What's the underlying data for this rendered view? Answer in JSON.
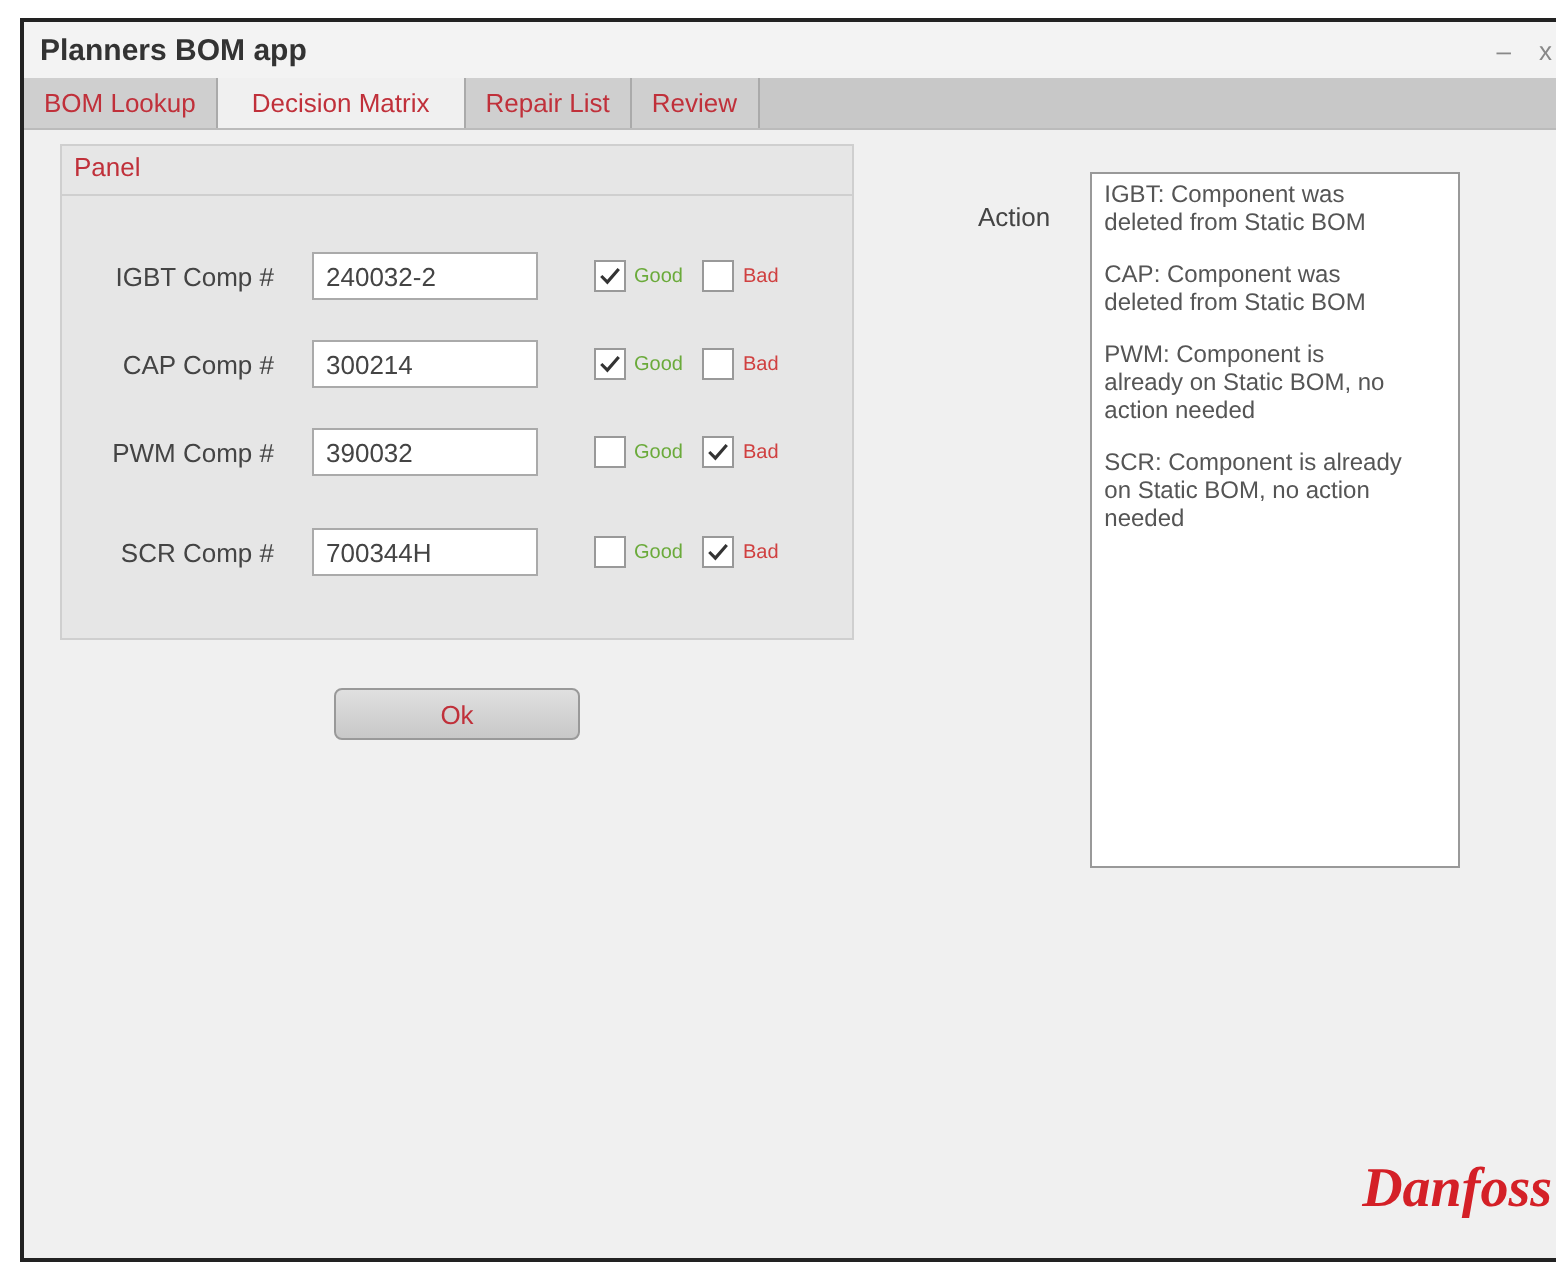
{
  "window": {
    "title": "Planners BOM app",
    "controls": [
      "–",
      "x"
    ]
  },
  "tabs": [
    {
      "label": "BOM Lookup",
      "selected": false
    },
    {
      "label": "Decision Matrix",
      "selected": true
    },
    {
      "label": "Repair List",
      "selected": false
    },
    {
      "label": "Review",
      "selected": false
    }
  ],
  "panel": {
    "title": "Panel",
    "rows": [
      {
        "label": "IGBT Comp #",
        "value": "240032-2",
        "good_label": "Good",
        "good": true,
        "bad_label": "Bad",
        "bad": false
      },
      {
        "label": "CAP Comp #",
        "value": "300214",
        "good_label": "Good",
        "good": true,
        "bad_label": "Bad",
        "bad": false
      },
      {
        "label": "PWM Comp #",
        "value": "390032",
        "good_label": "Good",
        "good": false,
        "bad_label": "Bad",
        "bad": true
      },
      {
        "label": "SCR Comp #",
        "value": "700344H",
        "good_label": "Good",
        "good": false,
        "bad_label": "Bad",
        "bad": true
      }
    ]
  },
  "ok_button": "Ok",
  "action": {
    "label": "Action",
    "paragraphs": [
      "IGBT: Component was deleted from Static BOM",
      "CAP: Component was deleted from Static BOM",
      "PWM: Component is already on Static BOM, no action needed",
      "SCR: Component is already on Static BOM, no action needed"
    ]
  },
  "logo": "Danfoss"
}
